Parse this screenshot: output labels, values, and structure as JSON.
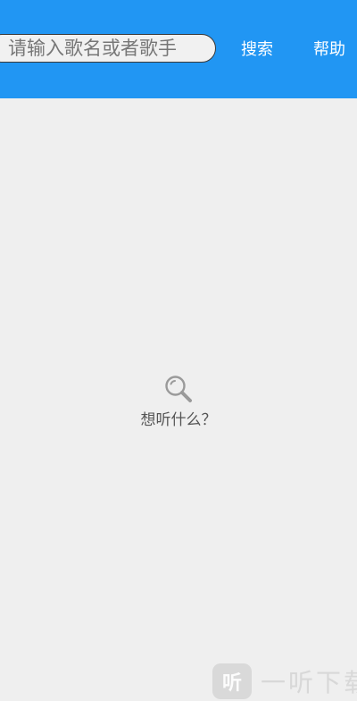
{
  "header": {
    "search_placeholder": "请输入歌名或者歌手",
    "search_button": "搜索",
    "help_button": "帮助"
  },
  "empty_state": {
    "icon": "search-icon",
    "message": "想听什么？"
  },
  "watermark": {
    "logo_text": "听",
    "text": "一听下载"
  },
  "colors": {
    "header_bg": "#2196f3",
    "page_bg": "#efefef"
  }
}
